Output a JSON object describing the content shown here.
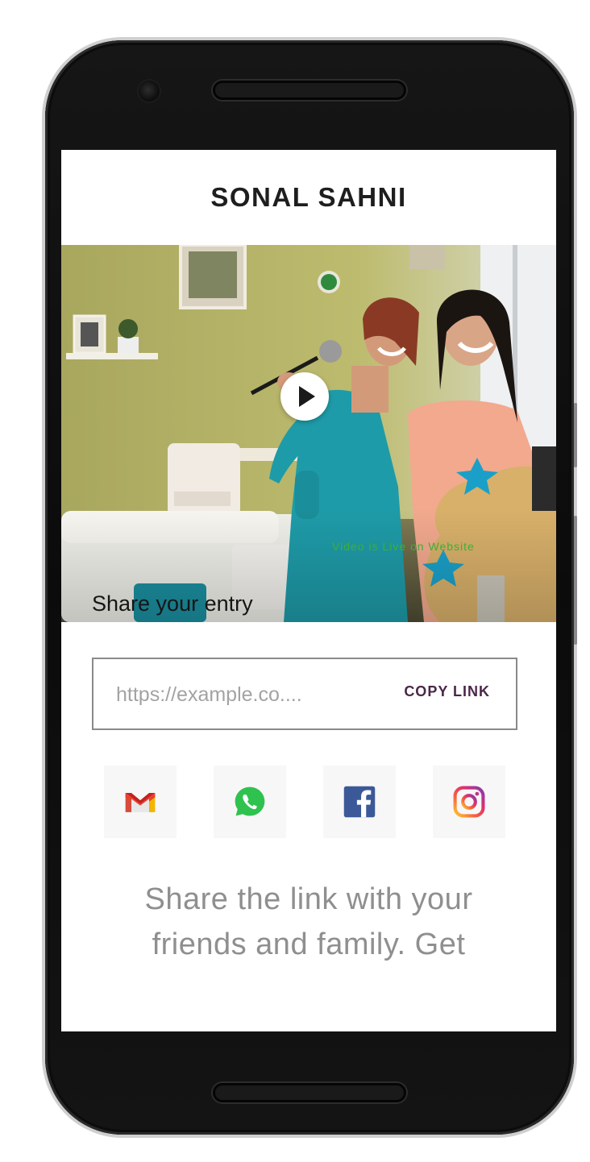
{
  "header": {
    "title": "SONAL SAHNI"
  },
  "video": {
    "status_text": "Video is Live on Website",
    "caption": "Share your entry",
    "play_icon": "play-icon"
  },
  "link": {
    "placeholder": "https://example.co....",
    "copy_label": "COPY LINK"
  },
  "social": [
    {
      "name": "gmail",
      "icon": "gmail-icon",
      "color": "#EA4335"
    },
    {
      "name": "whatsapp",
      "icon": "whatsapp-icon",
      "color": "#25D366"
    },
    {
      "name": "facebook",
      "icon": "facebook-icon",
      "color": "#3B5998"
    },
    {
      "name": "instagram",
      "icon": "instagram-icon",
      "color": "#E1306C"
    }
  ],
  "info": {
    "text": "Share the link with your friends and family. Get"
  },
  "colors": {
    "accent": "#4a2748",
    "status_green": "#3fae3a",
    "device": "#111111"
  }
}
